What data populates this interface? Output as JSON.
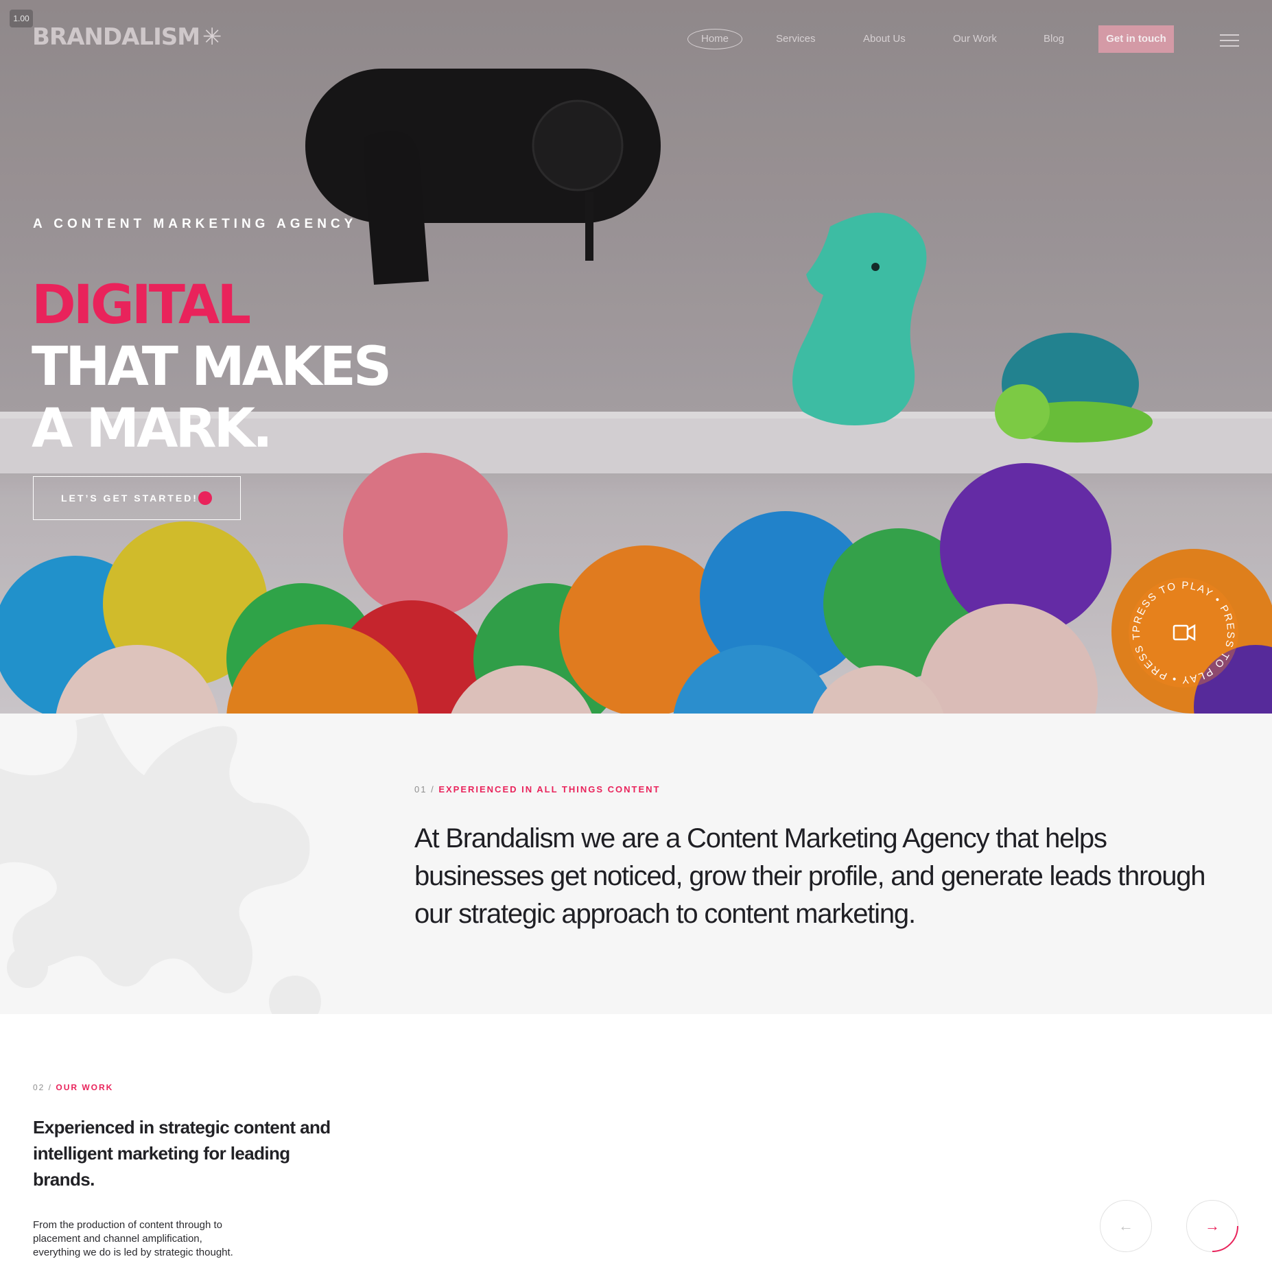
{
  "zoom_badge": "1.00",
  "brand": {
    "logo_text": "BRANDALISM",
    "logo_mark": "✳"
  },
  "nav": {
    "items": [
      "Home",
      "Services",
      "About Us",
      "Our Work",
      "Blog"
    ],
    "cta": "Get in touch",
    "menu_icon": "hamburger-icon"
  },
  "hero": {
    "eyebrow": "A CONTENT MARKETING AGENCY",
    "headline_accent": "DIGITAL",
    "headline_line2": "THAT MAKES",
    "headline_line3": "A MARK.",
    "cta_label": "LET’S GET STARTED!",
    "play_badge_text": "PRESS TO PLAY • PRESS TO PLAY • PRESS TO PLAY •",
    "play_icon": "video-camera-icon"
  },
  "about": {
    "number": "01 /",
    "label": "EXPERIENCED IN ALL THINGS CONTENT",
    "body": "At Brandalism we are a Content Marketing Agency that helps businesses get noticed, grow their profile, and generate leads through our strategic approach to content marketing."
  },
  "work": {
    "number": "02 /",
    "label": "OUR WORK",
    "title": "Experienced in strategic content and intelligent marketing for leading brands.",
    "description": "From the production of content through to placement and channel amplification, everything we do is led by strategic thought.",
    "prev_icon": "arrow-left-icon",
    "next_icon": "arrow-right-icon"
  },
  "colors": {
    "accent": "#e9235b",
    "about_bg": "#f6f6f6",
    "text_dark": "#1f1f24"
  }
}
